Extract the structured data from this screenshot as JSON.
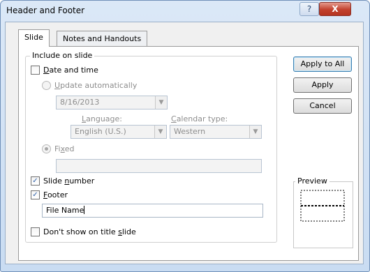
{
  "window": {
    "title": "Header and Footer",
    "help_glyph": "?",
    "close_glyph": "X"
  },
  "tabs": [
    {
      "label": "Slide",
      "active": true
    },
    {
      "label": "Notes and Handouts",
      "active": false
    }
  ],
  "include_group": {
    "label": "Include on slide",
    "date_time": {
      "label": "Date and time",
      "checked": false
    },
    "update_auto": {
      "label": "Update automatically",
      "selected": false
    },
    "date_value": "8/16/2013",
    "language": {
      "label": "Language:",
      "value": "English (U.S.)"
    },
    "calendar": {
      "label": "Calendar type:",
      "value": "Western"
    },
    "fixed": {
      "label": "Fixed",
      "selected": true,
      "value": ""
    },
    "slide_number": {
      "label": "Slide number",
      "checked": true
    },
    "footer": {
      "label": "Footer",
      "checked": true,
      "value": "File Name"
    }
  },
  "dont_show_title": {
    "label": "Don't show on title slide",
    "checked": false
  },
  "buttons": {
    "apply_all": "Apply to All",
    "apply": "Apply",
    "cancel": "Cancel"
  },
  "preview": {
    "label": "Preview"
  },
  "check_glyph": "✓",
  "dropdown_glyph": "▼",
  "colors": {
    "accent": "#2a5ea8",
    "close": "#c2412d"
  }
}
